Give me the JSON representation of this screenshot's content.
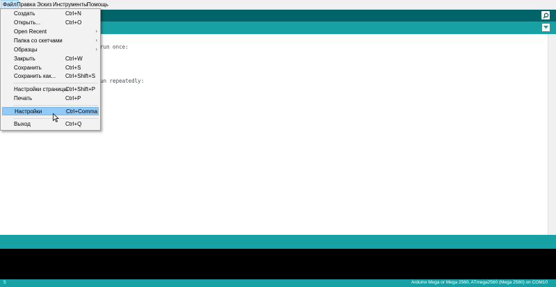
{
  "menubar": {
    "items": [
      "Файл",
      "Правка",
      "Эскиз",
      "Инструменты",
      "Помощь"
    ]
  },
  "editor": {
    "lines": [
      "run once:",
      "un repeatedly:"
    ]
  },
  "file_menu": {
    "items": [
      {
        "label": "Создать",
        "shortcut": "Ctrl+N"
      },
      {
        "label": "Открыть...",
        "shortcut": "Ctrl+O"
      },
      {
        "label": "Open Recent",
        "shortcut": "",
        "submenu": true
      },
      {
        "label": "Папка со скетчами",
        "shortcut": "",
        "submenu": true
      },
      {
        "label": "Образцы",
        "shortcut": "",
        "submenu": true
      },
      {
        "label": "Закрыть",
        "shortcut": "Ctrl+W"
      },
      {
        "label": "Сохранить",
        "shortcut": "Ctrl+S"
      },
      {
        "label": "Сохранить как...",
        "shortcut": "Ctrl+Shift+S"
      },
      {
        "label": "Настройки страницы",
        "shortcut": "Ctrl+Shift+P"
      },
      {
        "label": "Печать",
        "shortcut": "Ctrl+P"
      },
      {
        "label": "Настройки",
        "shortcut": "Ctrl+Comma",
        "highlighted": true
      },
      {
        "label": "Выход",
        "shortcut": "Ctrl+Q"
      }
    ],
    "submenu_arrow": "›"
  },
  "icons": {
    "serial_monitor": "magnifier-icon",
    "tab_menu": "triangle-down-icon"
  },
  "status": {
    "line": "5",
    "board": "Arduino Mega or Mega 2560, ATmega2560 (Mega 2560) on COM10"
  },
  "colors": {
    "toolbar": "#006468",
    "tabbar": "#17a1a5",
    "menu_highlight": "#91c9f7"
  }
}
